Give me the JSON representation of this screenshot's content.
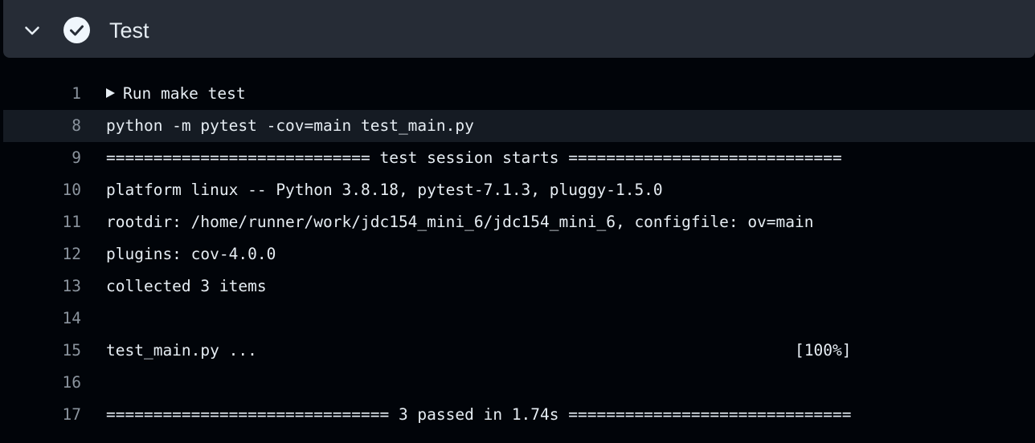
{
  "step": {
    "title": "Test",
    "status": "success",
    "icons": {
      "toggle": "chevron-down-icon",
      "status": "check-circle-icon"
    }
  },
  "colors": {
    "background": "#010409",
    "header": "#262c36",
    "highlight": "#151b23",
    "text": "#e6edf3",
    "line_number": "#8b949e"
  },
  "log": {
    "group": {
      "number": "1",
      "label": "Run make test",
      "collapsed": true
    },
    "lines": [
      {
        "number": "8",
        "text": "python -m pytest -cov=main test_main.py"
      },
      {
        "number": "9",
        "text": "============================ test session starts ============================="
      },
      {
        "number": "10",
        "text": "platform linux -- Python 3.8.18, pytest-7.1.3, pluggy-1.5.0"
      },
      {
        "number": "11",
        "text": "rootdir: /home/runner/work/jdc154_mini_6/jdc154_mini_6, configfile: ov=main"
      },
      {
        "number": "12",
        "text": "plugins: cov-4.0.0"
      },
      {
        "number": "13",
        "text": "collected 3 items"
      },
      {
        "number": "14",
        "text": ""
      },
      {
        "number": "15",
        "text": "test_main.py ...                                                         [100%]"
      },
      {
        "number": "16",
        "text": ""
      },
      {
        "number": "17",
        "text": "============================== 3 passed in 1.74s =============================="
      }
    ]
  }
}
